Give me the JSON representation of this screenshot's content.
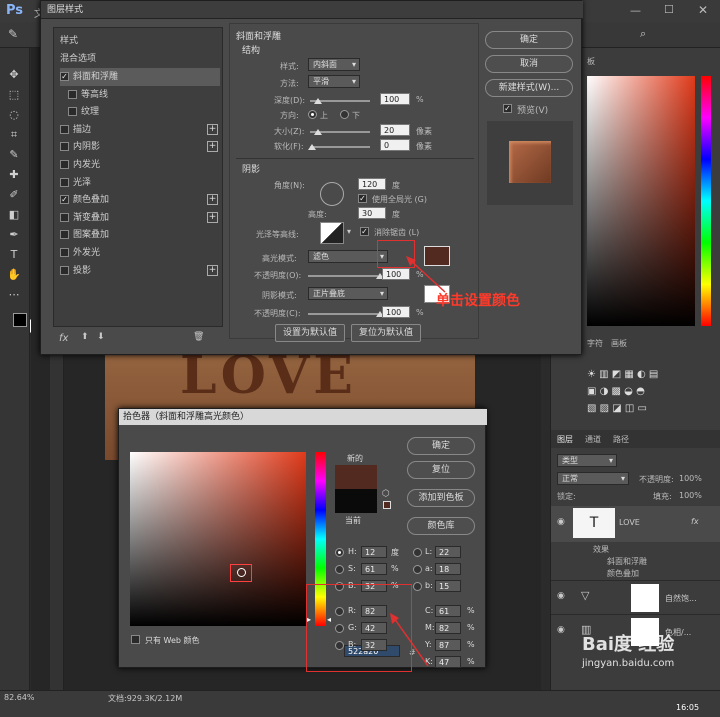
{
  "app": {
    "logo": "Ps",
    "menu_first": "文"
  },
  "layer_style": {
    "title": "图层样式",
    "styles_header": "样式",
    "blend_options": "混合选项",
    "items": [
      {
        "label": "斜面和浮雕",
        "checked": true,
        "plus": false
      },
      {
        "label": "等高线",
        "checked": false,
        "plus": false
      },
      {
        "label": "纹理",
        "checked": false,
        "plus": false
      },
      {
        "label": "描边",
        "checked": false,
        "plus": true
      },
      {
        "label": "内阴影",
        "checked": false,
        "plus": true
      },
      {
        "label": "内发光",
        "checked": false,
        "plus": false
      },
      {
        "label": "光泽",
        "checked": false,
        "plus": false
      },
      {
        "label": "颜色叠加",
        "checked": true,
        "plus": true
      },
      {
        "label": "渐变叠加",
        "checked": false,
        "plus": true
      },
      {
        "label": "图案叠加",
        "checked": false,
        "plus": false
      },
      {
        "label": "外发光",
        "checked": false,
        "plus": false
      },
      {
        "label": "投影",
        "checked": false,
        "plus": true
      }
    ],
    "fx": "fx",
    "bevel_title": "斜面和浮雕",
    "structure": "结构",
    "style_label": "样式:",
    "style_value": "内斜面",
    "method_label": "方法:",
    "method_value": "平滑",
    "depth_label": "深度(D):",
    "depth_value": "100",
    "percent": "%",
    "direction_label": "方向:",
    "dir_up": "上",
    "dir_down": "下",
    "size_label": "大小(Z):",
    "size_value": "20",
    "soften_label": "软化(F):",
    "soften_value": "0",
    "px": "像素",
    "shading": "阴影",
    "angle_label": "角度(N):",
    "angle_value": "120",
    "deg": "度",
    "global_light": "使用全局光 (G)",
    "altitude_label": "高度:",
    "altitude_value": "30",
    "gloss_label": "光泽等高线:",
    "antialias": "消除锯齿 (L)",
    "highlight_mode_label": "高光模式:",
    "highlight_mode": "滤色",
    "opacity_label": "不透明度(O):",
    "highlight_opacity": "100",
    "shadow_mode_label": "阴影模式:",
    "shadow_mode": "正片叠底",
    "opacity_label2": "不透明度(C):",
    "shadow_opacity": "100",
    "set_default": "设置为默认值",
    "reset_default": "复位为默认值",
    "ok": "确定",
    "cancel": "取消",
    "new_style": "新建样式(W)...",
    "preview": "预览(V)",
    "highlight_color": "#522a20"
  },
  "annotation": "单击设置颜色",
  "picker": {
    "title": "拾色器（斜面和浮雕高光颜色）",
    "new_label": "新的",
    "current_label": "当前",
    "ok": "确定",
    "reset": "复位",
    "add_swatch": "添加到色板",
    "color_lib": "颜色库",
    "web_only": "只有 Web 颜色",
    "H": "12",
    "S": "61",
    "B": "32",
    "R": "82",
    "G": "42",
    "Bv": "32",
    "L": "22",
    "a": "18",
    "b": "15",
    "C": "61",
    "M": "82",
    "Y": "87",
    "K": "47",
    "hex": "522a20",
    "deg": "度",
    "pct": "%",
    "lbl_H": "H:",
    "lbl_S": "S:",
    "lbl_B": "B:",
    "lbl_R": "R:",
    "lbl_G": "G:",
    "lbl_Bv": "B:",
    "lbl_L": "L:",
    "lbl_a": "a:",
    "lbl_b": "b:",
    "lbl_C": "C:",
    "lbl_M": "M:",
    "lbl_Y": "Y:",
    "lbl_K": "K:",
    "lbl_hex": "#",
    "new_color": "#522a20",
    "current_color": "#0a0a0a"
  },
  "canvas": {
    "text": "LOVE"
  },
  "status": {
    "zoom": "82.64%",
    "doc": "文档:929.3K/2.12M",
    "time": "16:05"
  },
  "layers": {
    "tab_layers": "图层",
    "tab_channels": "通道",
    "tab_paths": "路径",
    "kind": "类型",
    "blend": "正常",
    "opacity_label": "不透明度:",
    "opacity": "100%",
    "lock_label": "锁定:",
    "fill_label": "填充:",
    "fill": "100%",
    "text_layer": "LOVE",
    "effects": "效果",
    "eff1": "斜面和浮雕",
    "eff2": "颜色叠加",
    "layer2": "自然饱...",
    "layer3": "色相/...",
    "fx": "fx"
  },
  "watermark": {
    "brand": "Bai度 经验",
    "url": "jingyan.baidu.com"
  },
  "right_tabs": {
    "swatches": "板",
    "adjust1": "字符",
    "adjust2": "画板"
  }
}
